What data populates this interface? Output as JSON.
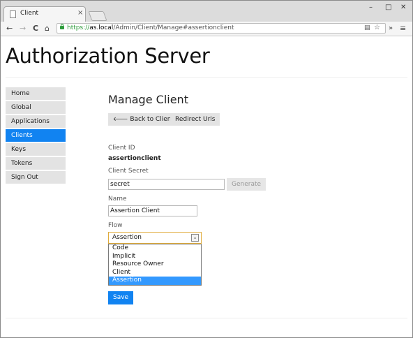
{
  "browser": {
    "tab_title": "Client",
    "tab_close": "×",
    "window_controls": {
      "minimize": "–",
      "maximize": "□",
      "close": "✕"
    },
    "nav": {
      "back": "←",
      "forward": "→",
      "reload": "C",
      "home": "⌂"
    },
    "url": {
      "scheme": "https://",
      "host": "as.local",
      "path": "/Admin/Client/Manage#assertionclient"
    },
    "omnibox_icons": {
      "page": "▤",
      "star": "☆"
    },
    "extensions": "»",
    "menu": "≡",
    "colors": {
      "secure": "#2e9c3c"
    }
  },
  "site": {
    "brand": "Authorization Server"
  },
  "sidebar": {
    "items": [
      {
        "label": "Home",
        "active": false
      },
      {
        "label": "Global",
        "active": false
      },
      {
        "label": "Applications",
        "active": false
      },
      {
        "label": "Clients",
        "active": true
      },
      {
        "label": "Keys",
        "active": false
      },
      {
        "label": "Tokens",
        "active": false
      },
      {
        "label": "Sign Out",
        "active": false
      }
    ],
    "active_color": "#1183f1"
  },
  "main": {
    "title": "Manage Client",
    "back_button": {
      "icon": "🡐",
      "label": "Back to Clients"
    },
    "redirect_button": "Redirect Uris",
    "client_id": {
      "label": "Client ID",
      "value": "assertionclient"
    },
    "client_secret": {
      "label": "Client Secret",
      "value": "secret",
      "generate": "Generate"
    },
    "name": {
      "label": "Name",
      "value": "Assertion Client"
    },
    "flow": {
      "label": "Flow",
      "selected": "Assertion",
      "arrow": "⌄",
      "options": [
        "Code",
        "Implicit",
        "Resource Owner",
        "Client",
        "Assertion"
      ],
      "highlighted": "Assertion"
    },
    "save_label": "Save"
  }
}
